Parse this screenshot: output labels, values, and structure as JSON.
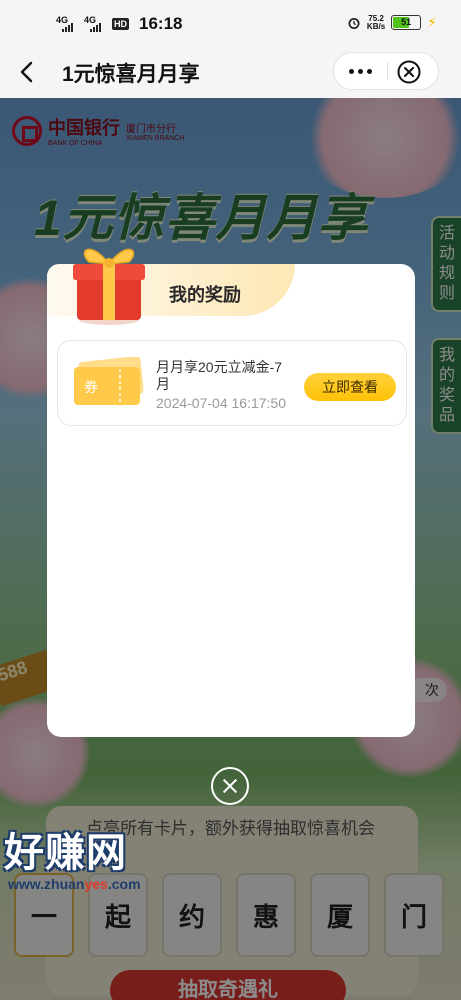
{
  "status_bar": {
    "signal1": "4G",
    "signal2": "4G",
    "hd_badge": "HD",
    "time": "16:18",
    "net_speed_value": "75.2",
    "net_speed_unit": "KB/s",
    "battery": "51"
  },
  "nav": {
    "title": "1元惊喜月月享"
  },
  "background": {
    "bank_name": "中国银行",
    "bank_name_en": "BANK OF CHINA",
    "branch": "厦门市分行",
    "branch_en": "XIAMEN BRANCH",
    "hero_title": "1元惊喜月月享",
    "side_tab_rules": "活动规则",
    "side_tab_prizes": "我的奖品",
    "coupon_amount": "588",
    "times_suffix": "次",
    "tip": "点亮所有卡片，额外获得抽取惊喜机会",
    "cards": [
      "一",
      "起",
      "约",
      "惠",
      "厦",
      "门"
    ],
    "draw_button": "抽取奇遇礼"
  },
  "modal": {
    "title": "我的奖励",
    "rewards": [
      {
        "ticket_label": "券",
        "title": "月月享20元立减金-7月",
        "time": "2024-07-04 16:17:50",
        "button": "立即查看"
      }
    ]
  },
  "watermark": {
    "text": "好赚网",
    "url_prefix": "www.zhuan",
    "url_highlight": "yes",
    "url_suffix": ".com"
  },
  "colors": {
    "accent_yellow": "#ffc107",
    "modal_header": "#fde7b4",
    "gift_red": "#e23b2e",
    "bank_red": "#c8102e"
  },
  "icons": [
    "back-arrow-icon",
    "more-dots-icon",
    "close-circle-icon",
    "gift-box-icon",
    "coupon-ticket-icon",
    "alarm-icon",
    "battery-icon",
    "charging-icon"
  ]
}
